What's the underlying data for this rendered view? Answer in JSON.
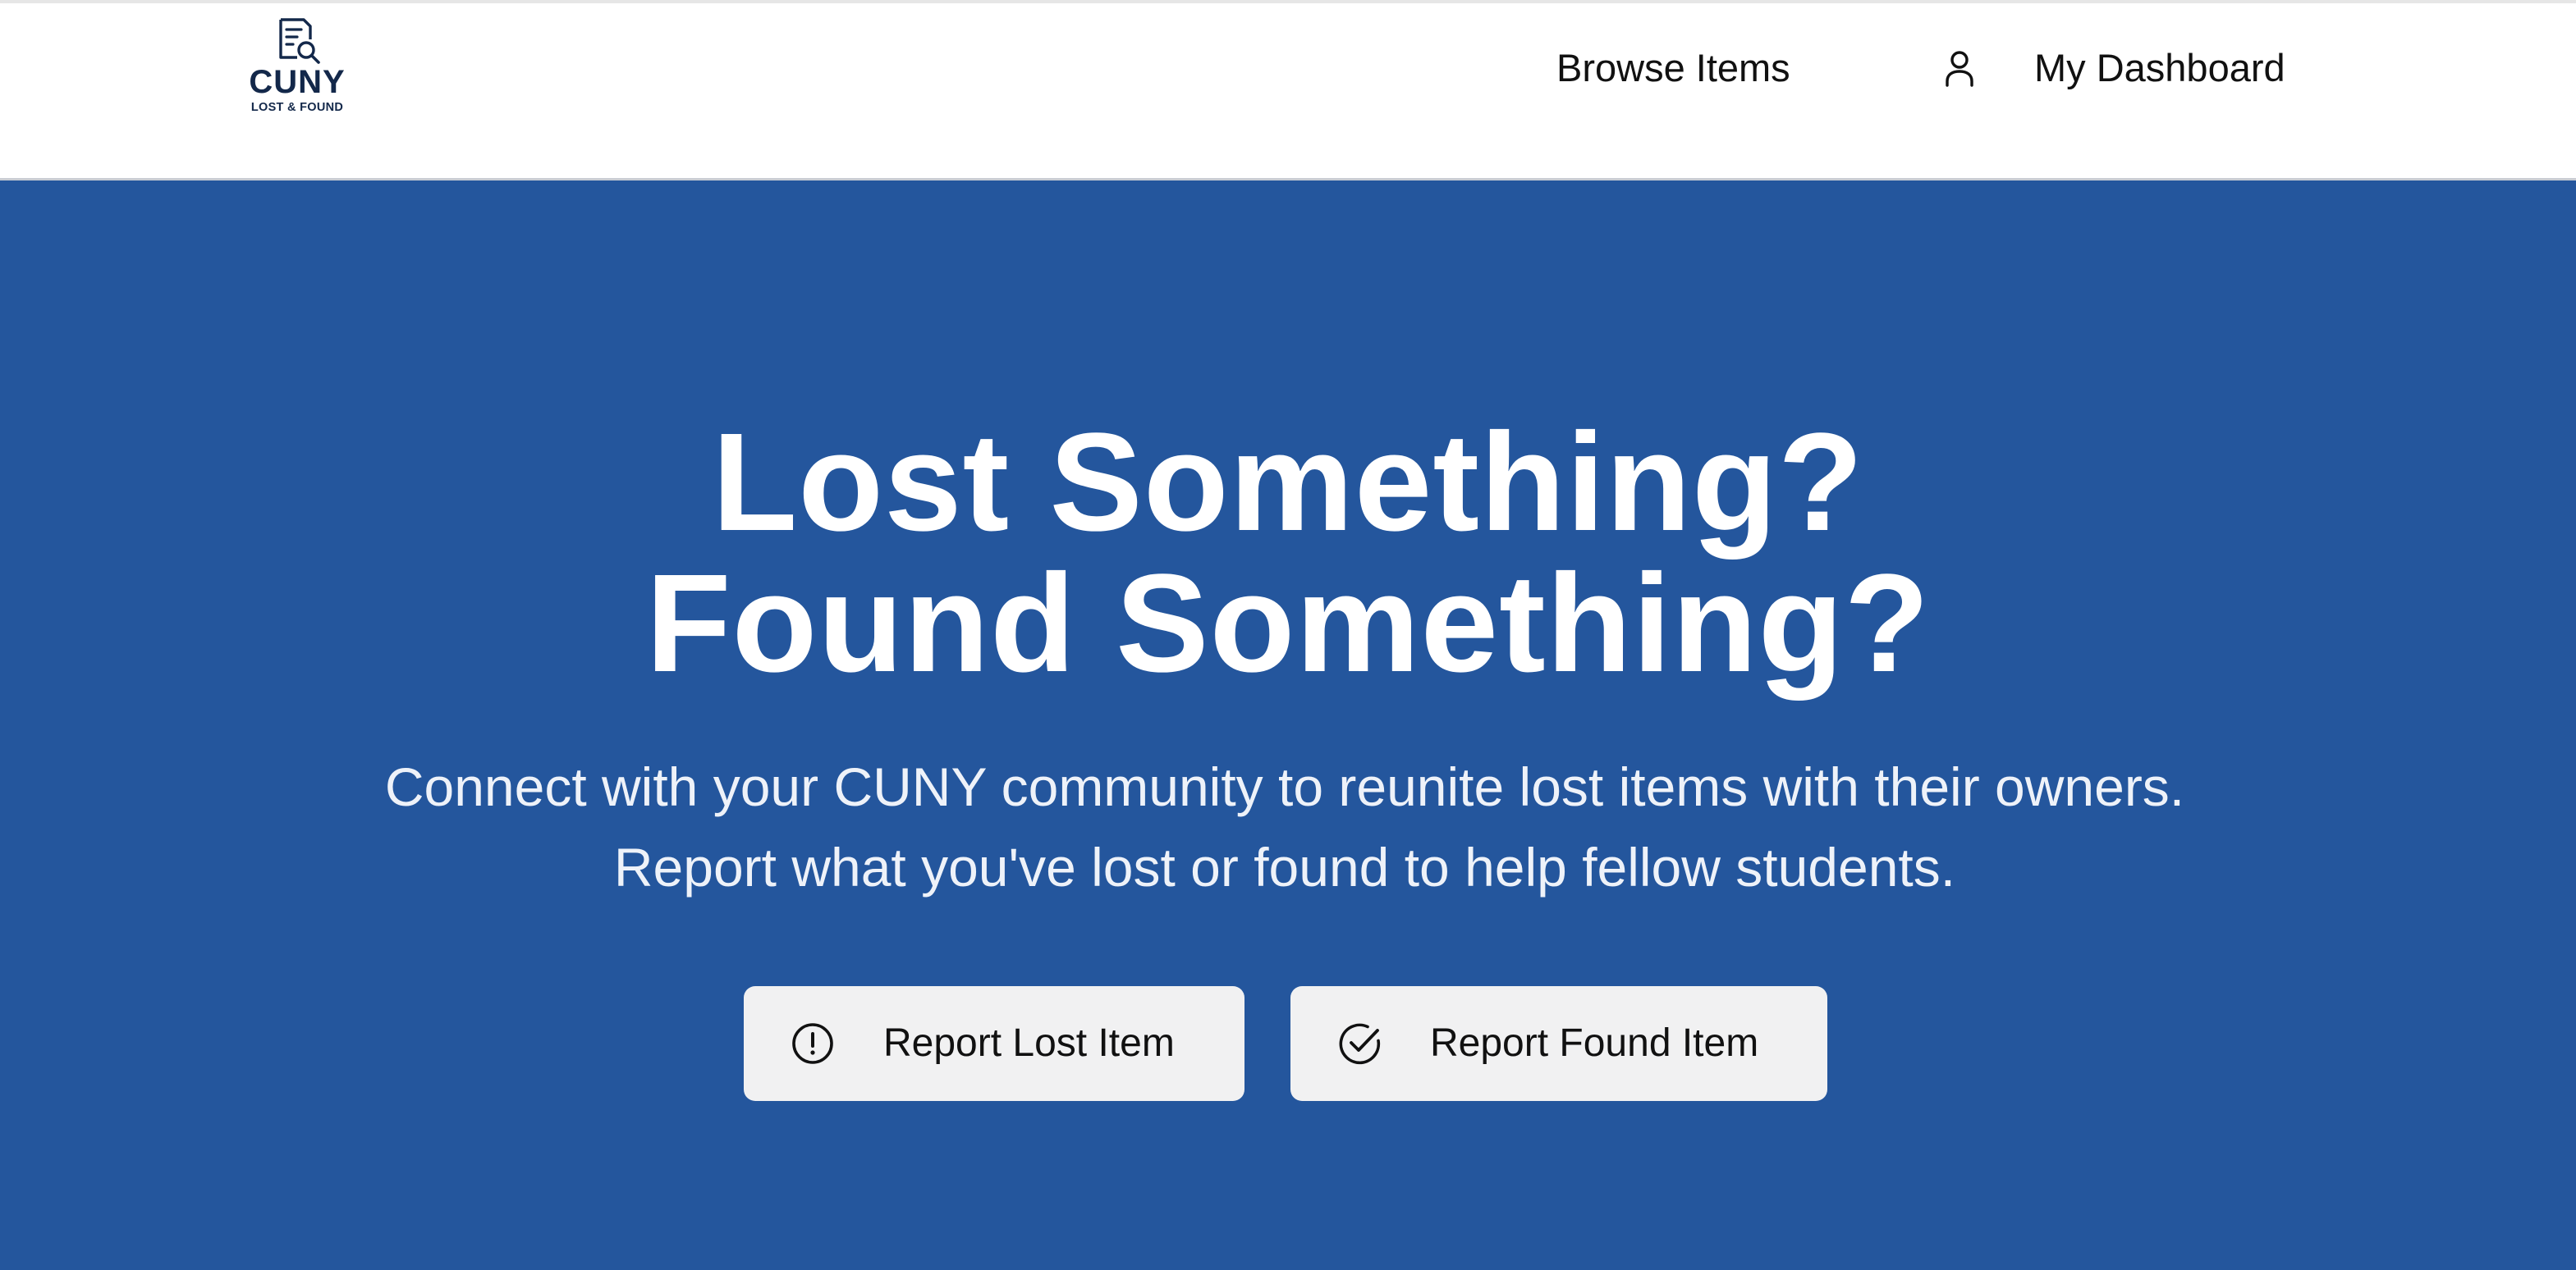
{
  "header": {
    "logo": {
      "title": "CUNY",
      "subtitle": "LOST & FOUND",
      "icon": "document-search-icon"
    },
    "nav": {
      "browse_label": "Browse Items",
      "dashboard_label": "My Dashboard",
      "dashboard_icon": "user-icon"
    }
  },
  "hero": {
    "title_line1": "Lost Something?",
    "title_line2": "Found Something?",
    "subtitle": "Connect with your CUNY community to reunite lost items with their owners. Report what you've lost or found to help fellow students.",
    "buttons": {
      "lost_label": "Report Lost Item",
      "lost_icon": "alert-circle-icon",
      "found_label": "Report Found Item",
      "found_icon": "check-circle-icon"
    }
  },
  "colors": {
    "hero_background": "#24569d",
    "logo_navy": "#13284a",
    "button_background": "#f1f1f2"
  }
}
